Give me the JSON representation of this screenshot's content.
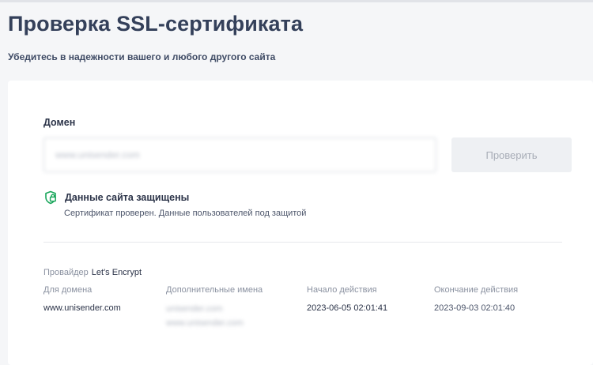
{
  "header": {
    "title": "Проверка SSL-сертификата",
    "subtitle": "Убедитесь в надежности вашего и любого другого сайта"
  },
  "form": {
    "domain_label": "Домен",
    "domain_value": "www.unisender.com",
    "check_button_label": "Проверить"
  },
  "status": {
    "icon": "shield-lock-icon",
    "title": "Данные сайта защищены",
    "description": "Сертификат проверен. Данные пользователей под защитой",
    "color": "#1aa65b"
  },
  "certificate": {
    "provider_label": "Провайдер",
    "provider": "Let's Encrypt",
    "columns": {
      "domain": "Для домена",
      "alt_names": "Дополнительные имена",
      "start": "Начало действия",
      "end": "Окончание действия"
    },
    "domain": "www.unisender.com",
    "alt_names": [
      "unisender.com",
      "www.unisender.com"
    ],
    "start": "2023-06-05 02:01:41",
    "end": "2023-09-03 02:01:40"
  }
}
